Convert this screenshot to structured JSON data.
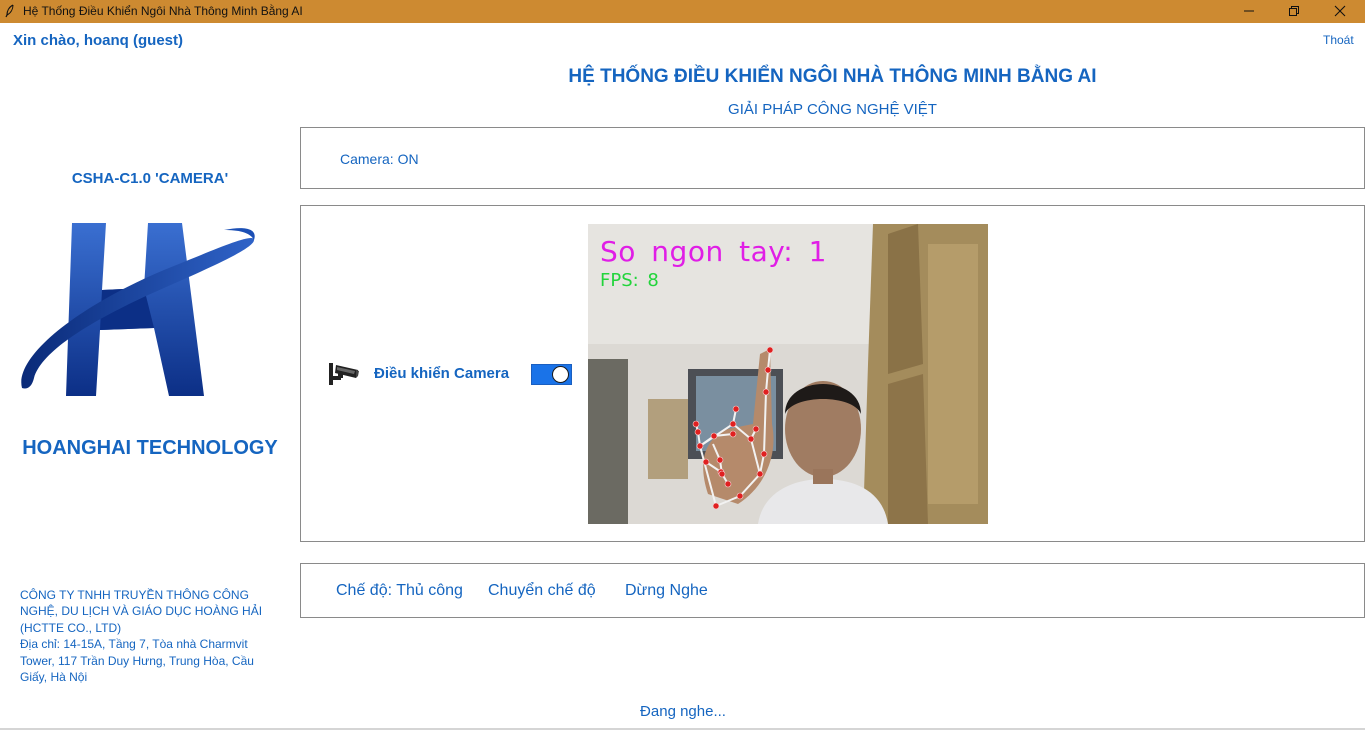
{
  "window": {
    "title": "Hệ Thống Điều Khiển Ngôi Nhà Thông Minh Bằng AI",
    "titlebar_color": "#cd8a31",
    "controls": {
      "minimize_icon": "minimize-icon",
      "restore_icon": "restore-icon",
      "close_icon": "close-icon"
    }
  },
  "header": {
    "greeting": "Xin chào, hoanq (guest)",
    "logout_label": "Thoát",
    "title": "HỆ THỐNG ĐIỀU KHIỂN NGÔI NHÀ THÔNG MINH BẰNG AI",
    "subtitle": "GIẢI PHÁP CÔNG NGHỆ VIỆT"
  },
  "sidebar": {
    "product": "CSHA-C1.0 'CAMERA'",
    "logo_icon": "company-logo-h",
    "brand": "HOANGHAI TECHNOLOGY",
    "company_lines": [
      "CÔNG TY TNHH TRUYỀN THÔNG CÔNG",
      "NGHỆ, DU LỊCH VÀ GIÁO DỤC HOÀNG HẢI",
      "(HCTTE CO., LTD)",
      "Địa chỉ: 14-15A, Tầng 7, Tòa nhà Charmvit",
      "Tower, 117 Trần Duy Hưng, Trung Hòa, Cầu",
      "Giấy, Hà Nội"
    ]
  },
  "status": {
    "camera": "Camera: ON"
  },
  "camera_panel": {
    "control_icon": "cctv-camera-icon",
    "control_label": "Điều khiển Camera",
    "toggle_on": true,
    "feed": {
      "finger_count_text": "So ngon tay: 1",
      "fps_text": "FPS: 8",
      "overlay_colors": {
        "count": "#e01ee6",
        "fps": "#22d43b",
        "landmarks": "#e02020",
        "skeleton": "#f2f2f2"
      }
    }
  },
  "modes": {
    "current": "Chế độ: Thủ công",
    "switch_label": "Chuyển chế độ",
    "stop_label": "Dừng Nghe"
  },
  "footer": {
    "listening": "Đang nghe..."
  },
  "colors": {
    "accent": "#1565c0",
    "toggle": "#1a73e8"
  }
}
